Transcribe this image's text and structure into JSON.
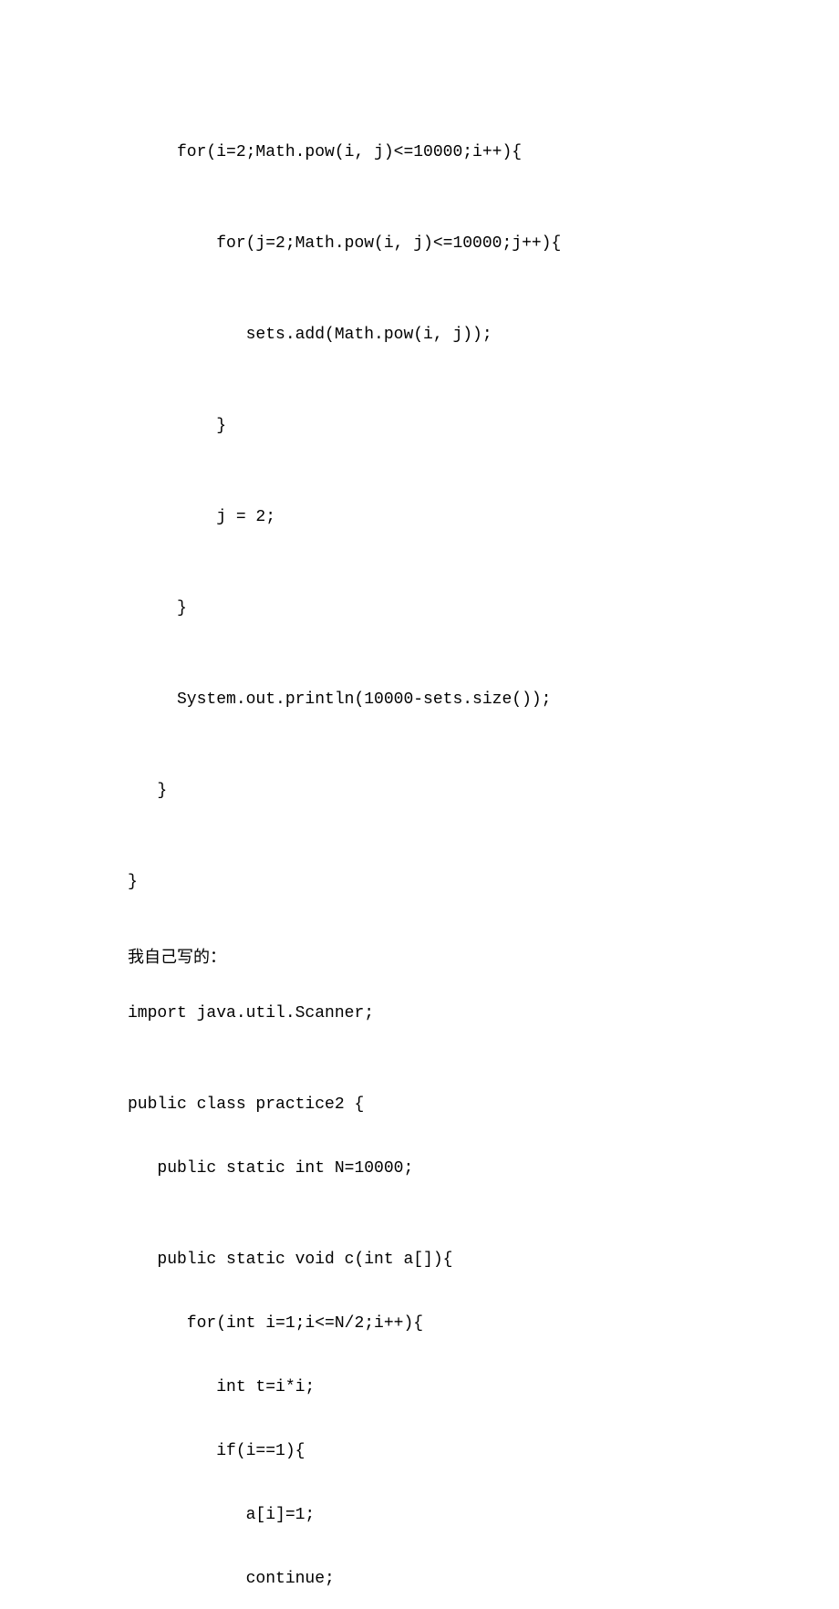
{
  "code1": {
    "l1": "     for(i=2;Math.pow(i, j)<=10000;i++){",
    "l2": "         for(j=2;Math.pow(i, j)<=10000;j++){",
    "l3": "            sets.add(Math.pow(i, j));",
    "l4": "         }",
    "l5": "         j = 2;",
    "l6": "     }",
    "l7": "     System.out.println(10000-sets.size());",
    "l8": "   }",
    "l9": "}"
  },
  "comment": "我自己写的：",
  "code2": {
    "l1": "import java.util.Scanner;",
    "l2": "",
    "l3": "public class practice2 {",
    "l4": "   public static int N=10000;",
    "l5": "",
    "l6": "   public static void c(int a[]){",
    "l7": "      for(int i=1;i<=N/2;i++){",
    "l8": "         int t=i*i;",
    "l9": "         if(i==1){",
    "l10": "            a[i]=1;",
    "l11": "            continue;"
  }
}
